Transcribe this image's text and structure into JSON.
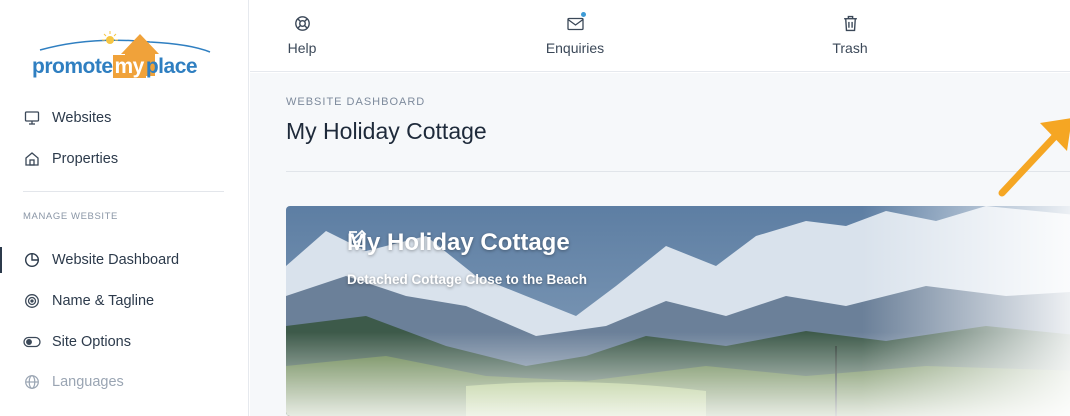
{
  "logo": {
    "part1": "promote",
    "part2": "my",
    "part3": "place"
  },
  "sidebar": {
    "items_top": [
      {
        "label": "Websites",
        "icon": "monitor-icon"
      },
      {
        "label": "Properties",
        "icon": "home-icon"
      }
    ],
    "section_label": "MANAGE WEBSITE",
    "items_manage": [
      {
        "label": "Website Dashboard",
        "icon": "pie-chart-icon",
        "active": true
      },
      {
        "label": "Name & Tagline",
        "icon": "target-icon"
      },
      {
        "label": "Site Options",
        "icon": "toggle-icon"
      },
      {
        "label": "Languages",
        "icon": "globe-icon",
        "muted": true
      }
    ]
  },
  "topnav": {
    "items": [
      {
        "label": "Help",
        "icon": "lifebuoy-icon"
      },
      {
        "label": "Enquiries",
        "icon": "mail-icon",
        "has_dot": true
      },
      {
        "label": "Trash",
        "icon": "trash-icon"
      }
    ]
  },
  "main": {
    "eyebrow": "WEBSITE DASHBOARD",
    "title": "My Holiday Cottage",
    "hero": {
      "title": "My Holiday Cottage",
      "subtitle": "Detached Cottage Close to the Beach"
    }
  },
  "colors": {
    "accent_arrow": "#f5a623",
    "brand_blue": "#2f7fc1",
    "brand_orange": "#f0a23a",
    "notification_dot": "#3e9bd6"
  }
}
